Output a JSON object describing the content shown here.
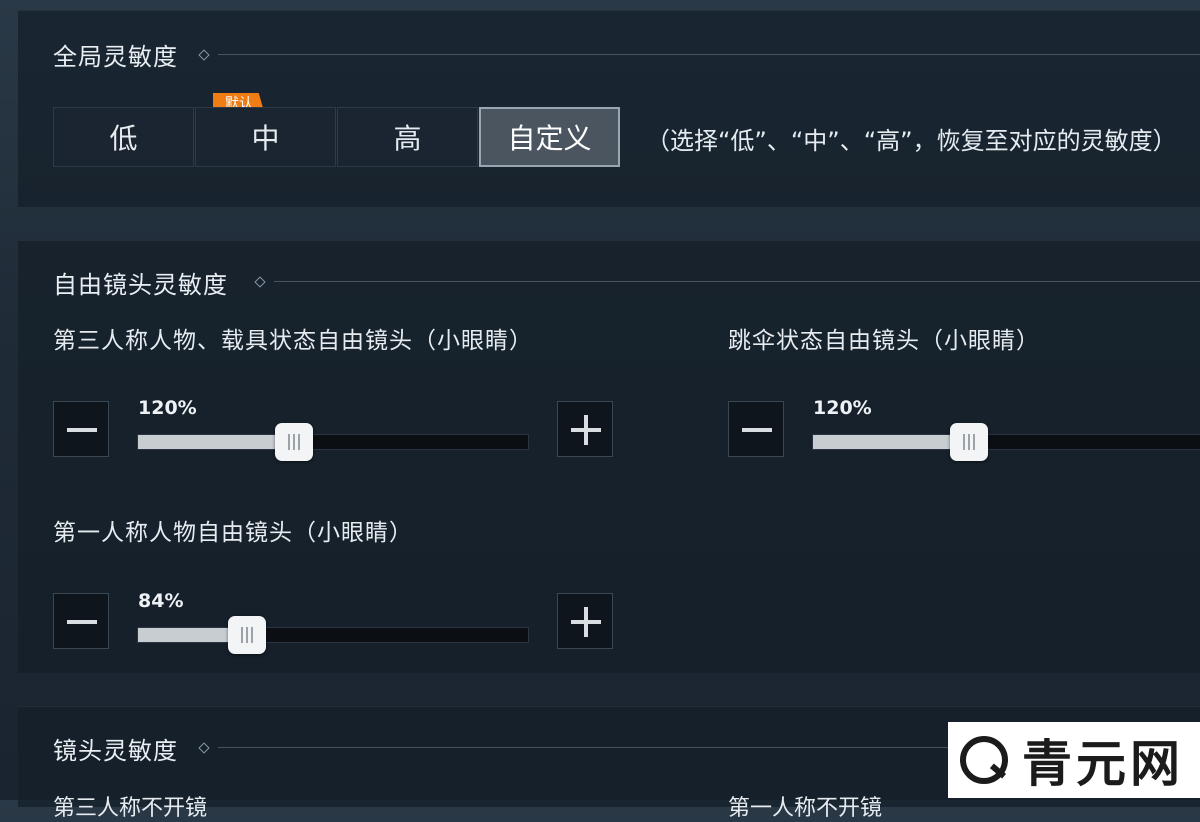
{
  "global": {
    "title": "全局灵敏度",
    "default_badge": "默认",
    "options": [
      "低",
      "中",
      "高",
      "自定义"
    ],
    "selected": "自定义",
    "hint": "（选择“低”、“中”、“高”，恢复至对应的灵敏度）"
  },
  "free_look": {
    "title": "自由镜头灵敏度",
    "settings": [
      {
        "label": "第三人称人物、载具状态自由镜头（小眼睛）",
        "value_text": "120%",
        "value": 120
      },
      {
        "label": "跳伞状态自由镜头（小眼睛）",
        "value_text": "120%",
        "value": 120
      },
      {
        "label": "第一人称人物自由镜头（小眼睛）",
        "value_text": "84%",
        "value": 84
      }
    ]
  },
  "lens": {
    "title": "镜头灵敏度",
    "cut_labels": [
      "第三人称不开镜",
      "第一人称不开镜"
    ]
  },
  "watermark": {
    "text": "青元网"
  },
  "colors": {
    "badge": "#ef7d14",
    "panel": "#141e28",
    "slider_fill": "#c8cdd2"
  }
}
